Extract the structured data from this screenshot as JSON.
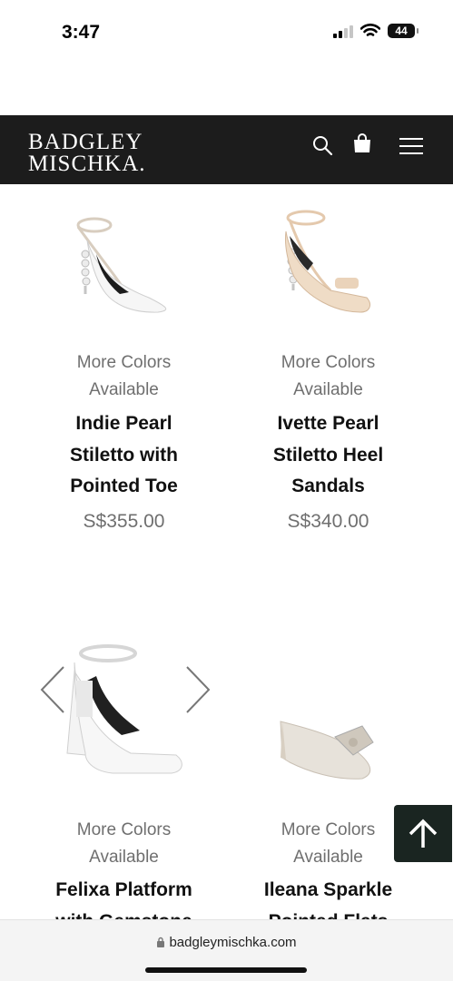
{
  "status_bar": {
    "time": "3:47",
    "battery": "44"
  },
  "header": {
    "logo_line1": "BADGLEY",
    "logo_line2": "MISCHKA."
  },
  "products": [
    {
      "more_colors_line1": "More Colors",
      "more_colors_line2": "Available",
      "name_lines": [
        "Indie Pearl",
        "Stiletto with",
        "Pointed Toe"
      ],
      "price": "S$355.00"
    },
    {
      "more_colors_line1": "More Colors",
      "more_colors_line2": "Available",
      "name_lines": [
        "Ivette Pearl",
        "Stiletto Heel",
        "Sandals"
      ],
      "price": "S$340.00"
    },
    {
      "more_colors_line1": "More Colors",
      "more_colors_line2": "Available",
      "name_lines": [
        "Felixa Platform",
        "with Gemstone"
      ]
    },
    {
      "more_colors_line1": "More Colors",
      "more_colors_line2": "Available",
      "name_lines": [
        "Ileana Sparkle",
        "Pointed Flats"
      ]
    }
  ],
  "browser": {
    "url": "badgleymischka.com"
  },
  "icons": [
    "search-icon",
    "shopping-bag-icon",
    "hamburger-menu-icon",
    "chevron-left-icon",
    "chevron-right-icon",
    "arrow-up-icon",
    "lock-icon"
  ]
}
